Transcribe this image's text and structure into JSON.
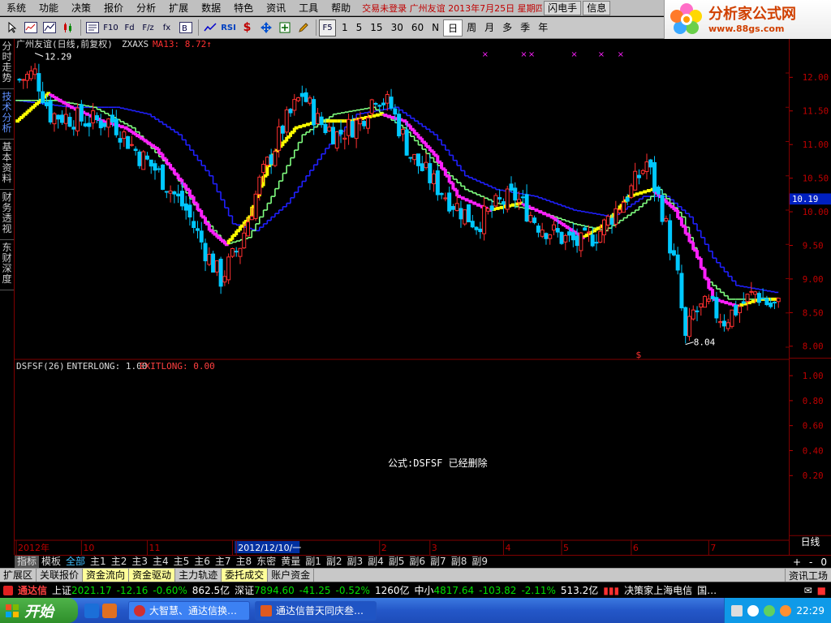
{
  "menubar": {
    "items": [
      "系统",
      "功能",
      "决策",
      "报价",
      "分析",
      "扩展",
      "数据",
      "特色",
      "资讯",
      "工具",
      "帮助"
    ],
    "title_text": "交易未登录 广州友谊 2013年7月25日 星期四",
    "flash_button": "闪电手",
    "info_button": "信息"
  },
  "logo": {
    "name": "分析家公式网",
    "url": "www.88gs.com"
  },
  "toolbar": {
    "icons": [
      "pointer-tool-icon",
      "minute-chart-icon",
      "line-chart-icon",
      "candlestick-chart-icon",
      "f10-icon",
      "f10-info-icon",
      "f11-icon",
      "f12-icon",
      "formula-icon",
      "indicator-icon",
      "rsi-icon",
      "dollar-icon",
      "move-icon",
      "zoom-icon",
      "draw-pencil-icon"
    ],
    "labels": {
      "f10": "F10",
      "f11": "Fd",
      "f12": "F/z",
      "formula": "fx",
      "rsi": "RSI",
      "f5": "F5"
    },
    "periods": [
      "1",
      "5",
      "15",
      "30",
      "60",
      "N",
      "日",
      "周",
      "月",
      "多",
      "季",
      "年"
    ],
    "active_period": "日"
  },
  "side_tabs": [
    "分时走势",
    "技术分析",
    "基本资料",
    "财务透视",
    "东财深度"
  ],
  "chart": {
    "main_header": {
      "name": "广州友谊(日线,前复权)",
      "indicator": "ZXAXS",
      "ma_label": "MA13: 8.72↑"
    },
    "high_label": "12.29",
    "low_label": "8.04",
    "current_price": "10.19",
    "y_ticks": [
      "12.00",
      "11.50",
      "11.00",
      "10.50",
      "10.00",
      "9.50",
      "9.00",
      "8.50",
      "8.00"
    ],
    "sub_header": {
      "formula": "DSFSF(26)",
      "enterlong": "ENTERLONG: 1.00",
      "exitlong": "EXITLONG: 0.00"
    },
    "sub_y_ticks": [
      "1.00",
      "0.80",
      "0.60",
      "0.40",
      "0.20"
    ],
    "sub_message": "公式:DSFSF 已经删除",
    "date_labels": [
      "2012年",
      "10",
      "11",
      "12",
      "2012/12/10/一",
      "2",
      "3",
      "4",
      "5",
      "6",
      "7"
    ],
    "period_tag": "日线"
  },
  "chart_data": {
    "type": "candlestick",
    "title": "广州友谊(日线,前复权)",
    "ylim": [
      7.9,
      12.3
    ],
    "y_ticks": [
      8.0,
      8.5,
      9.0,
      9.5,
      10.0,
      10.5,
      11.0,
      11.5,
      12.0
    ],
    "x_ticks": [
      "2012年",
      "10",
      "11",
      "12",
      "2012/12/10/一",
      "2",
      "3",
      "4",
      "5",
      "6",
      "7"
    ],
    "price_path": [
      [
        0,
        11.9
      ],
      [
        4,
        12.0
      ],
      [
        8,
        11.4
      ],
      [
        18,
        11.3
      ],
      [
        24,
        11.3
      ],
      [
        31,
        10.8
      ],
      [
        35,
        10.6
      ],
      [
        43,
        10.0
      ],
      [
        49,
        9.3
      ],
      [
        52,
        9.0
      ],
      [
        57,
        9.5
      ],
      [
        62,
        10.4
      ],
      [
        68,
        11.2
      ],
      [
        73,
        11.7
      ],
      [
        77,
        11.3
      ],
      [
        82,
        11.1
      ],
      [
        88,
        11.3
      ],
      [
        92,
        11.7
      ],
      [
        96,
        11.5
      ],
      [
        101,
        10.8
      ],
      [
        107,
        10.4
      ],
      [
        112,
        10.1
      ],
      [
        118,
        9.8
      ],
      [
        124,
        10.1
      ],
      [
        128,
        10.2
      ],
      [
        134,
        9.8
      ],
      [
        140,
        9.6
      ],
      [
        145,
        9.5
      ],
      [
        150,
        9.7
      ],
      [
        154,
        10.0
      ],
      [
        158,
        10.3
      ],
      [
        162,
        10.7
      ],
      [
        166,
        10.0
      ],
      [
        170,
        9.0
      ],
      [
        172,
        8.1
      ],
      [
        174,
        8.5
      ],
      [
        178,
        8.6
      ],
      [
        182,
        8.4
      ],
      [
        186,
        8.6
      ],
      [
        190,
        8.8
      ],
      [
        194,
        8.6
      ]
    ],
    "ma_series": [
      {
        "name": "MA13",
        "last": 8.72
      },
      {
        "name": "yellow-signal-line",
        "points": [
          [
            0,
            11.3
          ],
          [
            8,
            11.7
          ],
          [
            14,
            11.5
          ],
          [
            22,
            11.3
          ],
          [
            28,
            11.2
          ],
          [
            36,
            10.9
          ],
          [
            44,
            10.3
          ],
          [
            50,
            9.7
          ],
          [
            54,
            9.5
          ],
          [
            60,
            9.9
          ],
          [
            66,
            10.8
          ],
          [
            72,
            11.2
          ],
          [
            78,
            11.3
          ],
          [
            86,
            11.3
          ],
          [
            94,
            11.4
          ],
          [
            100,
            11.3
          ],
          [
            108,
            10.8
          ],
          [
            114,
            10.2
          ],
          [
            122,
            10.0
          ],
          [
            130,
            10.1
          ],
          [
            138,
            9.9
          ],
          [
            146,
            9.6
          ],
          [
            152,
            9.8
          ],
          [
            158,
            10.2
          ],
          [
            164,
            10.3
          ],
          [
            170,
            10.0
          ],
          [
            176,
            9.3
          ],
          [
            180,
            8.7
          ],
          [
            186,
            8.6
          ],
          [
            192,
            8.7
          ],
          [
            196,
            8.7
          ]
        ]
      },
      {
        "name": "green-signal-line",
        "points": [
          [
            0,
            11.6
          ],
          [
            10,
            11.6
          ],
          [
            20,
            11.5
          ],
          [
            30,
            11.2
          ],
          [
            40,
            10.6
          ],
          [
            48,
            9.9
          ],
          [
            54,
            9.5
          ],
          [
            60,
            9.6
          ],
          [
            66,
            10.2
          ],
          [
            74,
            11.1
          ],
          [
            82,
            11.4
          ],
          [
            92,
            11.5
          ],
          [
            100,
            11.2
          ],
          [
            108,
            10.7
          ],
          [
            116,
            10.3
          ],
          [
            124,
            10.1
          ],
          [
            134,
            10.0
          ],
          [
            144,
            9.8
          ],
          [
            152,
            9.7
          ],
          [
            160,
            10.0
          ],
          [
            166,
            10.3
          ],
          [
            172,
            9.9
          ],
          [
            178,
            9.0
          ],
          [
            184,
            8.7
          ],
          [
            196,
            8.7
          ]
        ]
      },
      {
        "name": "blue-signal-line",
        "points": [
          [
            0,
            11.6
          ],
          [
            14,
            11.5
          ],
          [
            26,
            11.5
          ],
          [
            34,
            11.4
          ],
          [
            42,
            11.1
          ],
          [
            50,
            10.5
          ],
          [
            56,
            9.8
          ],
          [
            62,
            9.7
          ],
          [
            70,
            10.1
          ],
          [
            80,
            10.9
          ],
          [
            88,
            11.4
          ],
          [
            98,
            11.5
          ],
          [
            108,
            11.1
          ],
          [
            116,
            10.5
          ],
          [
            124,
            10.3
          ],
          [
            134,
            10.2
          ],
          [
            144,
            10.0
          ],
          [
            154,
            9.9
          ],
          [
            162,
            10.2
          ],
          [
            168,
            10.2
          ],
          [
            174,
            9.9
          ],
          [
            180,
            9.3
          ],
          [
            186,
            8.9
          ],
          [
            196,
            8.8
          ]
        ]
      }
    ],
    "highest": 12.29,
    "lowest": 8.04,
    "last": 10.19,
    "sub_indicator": {
      "name": "DSFSF(26)",
      "ENTERLONG": 1.0,
      "EXITLONG": 0.0,
      "ylim": [
        0,
        1.1
      ]
    }
  },
  "vtabs": {
    "items": [
      "指标",
      "模板",
      "全部",
      "主1",
      "主2",
      "主3",
      "主4",
      "主5",
      "主6",
      "主7",
      "主8",
      "东密",
      "黄量",
      "副1",
      "副2",
      "副3",
      "副4",
      "副5",
      "副6",
      "副7",
      "副8",
      "副9"
    ],
    "active": "全部",
    "right": [
      "+",
      "-",
      "0"
    ]
  },
  "bottom_tabs": {
    "items": [
      "扩展区",
      "关联报价",
      "资金流向",
      "资金驱动",
      "主力轨迹",
      "委托成交",
      "账户资金"
    ],
    "right": "资讯工场"
  },
  "ticker": {
    "brand": "通达信",
    "sh_label": "上证",
    "sh_value": "2021.17",
    "sh_change": "-12.16",
    "sh_pct": "-0.60%",
    "sh_amount": "862.5亿",
    "sz_label": "深证",
    "sz_value": "7894.60",
    "sz_change": "-41.25",
    "sz_pct": "-0.52%",
    "sz_amount": "1260亿",
    "zx_label": "中小",
    "zx_value": "4817.64",
    "zx_change": "-103.82",
    "zx_pct": "-2.11%",
    "zx_amount": "513.2亿",
    "server": "决策家上海电信",
    "server_tail": "国…"
  },
  "taskbar": {
    "start": "开始",
    "tasks": [
      "大智慧、通达信换…",
      "通达信普天同庆叁…"
    ],
    "clock": "22:29"
  },
  "colors": {
    "up": "#ff3030",
    "down": "#00c8ff",
    "bg": "#000000",
    "frame": "#800000",
    "yellow": "#ffff00",
    "magenta": "#ff20ff",
    "green_line": "#80ff80",
    "blue_line": "#2020ff"
  }
}
